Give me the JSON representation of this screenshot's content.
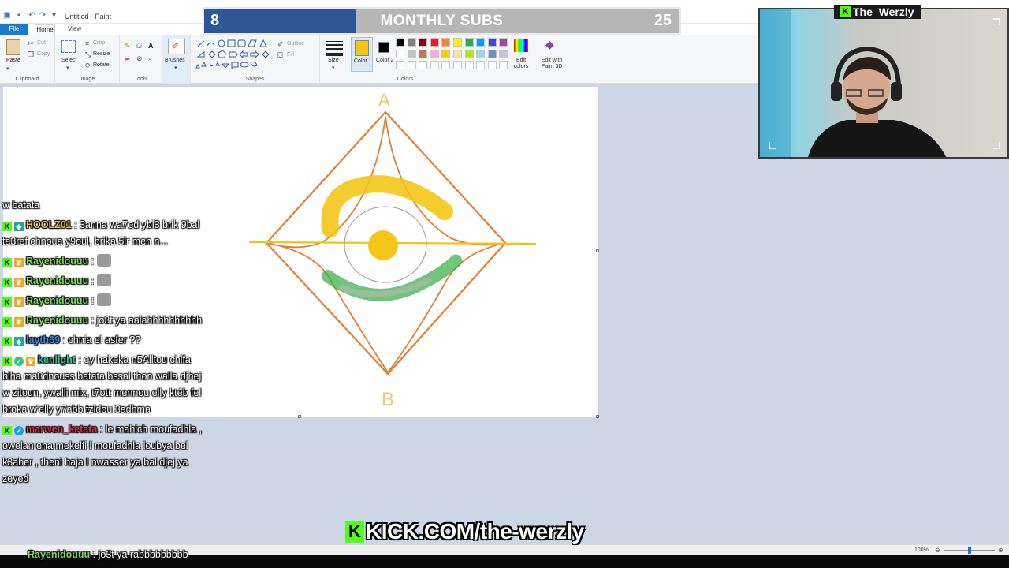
{
  "window": {
    "title": "Untitled - Paint"
  },
  "menu": {
    "file": "File",
    "home": "Home",
    "view": "View"
  },
  "ribbon": {
    "clipboard": {
      "label": "Clipboard",
      "paste": "Paste",
      "cut": "Cut",
      "copy": "Copy"
    },
    "image": {
      "label": "Image",
      "select": "Select",
      "crop": "Crop",
      "resize": "Resize",
      "rotate": "Rotate"
    },
    "tools": {
      "label": "Tools"
    },
    "brushes": {
      "label": "Brushes"
    },
    "shapes": {
      "label": "Shapes",
      "outline": "Outline",
      "fill": "Fill"
    },
    "size": {
      "label": "Size"
    },
    "colors": {
      "label": "Colors",
      "color1": "Color 1",
      "color2": "Color 2",
      "edit_colors": "Edit colors",
      "paint3d": "Edit with Paint 3D",
      "color1_value": "#f5c518",
      "color2_value": "#000000",
      "palette_row1": [
        "#000000",
        "#7f7f7f",
        "#880015",
        "#ed1c24",
        "#ff7f27",
        "#fff200",
        "#22b14c",
        "#00a2e8",
        "#3f48cc",
        "#a349a4"
      ],
      "palette_row2": [
        "#ffffff",
        "#c3c3c3",
        "#b97a57",
        "#ffaec9",
        "#ffc90e",
        "#efe4b0",
        "#b5e61d",
        "#99d9ea",
        "#7092be",
        "#c8bfe7"
      ]
    }
  },
  "canvas": {
    "letter_top": "A",
    "letter_bottom": "B"
  },
  "status": {
    "zoom": "100%"
  },
  "subs_goal": {
    "current": "8",
    "label": "MONTHLY SUBS",
    "goal": "25",
    "progress": 0.32
  },
  "webcam": {
    "channel_name": "The_Werzly"
  },
  "chat": [
    {
      "user": "",
      "color": "#ffffff",
      "badges": [],
      "text": "w batata",
      "emotes": 0
    },
    {
      "user": "HOOLZ01",
      "color": "#f2c230",
      "badges": [
        "kick",
        "og"
      ],
      "text": ": 3anna wa7ed ybi3 brik 9bal ta3ref chnoua y9oul, brika 5ir men n...",
      "emotes": 0
    },
    {
      "user": "Rayenidouuu",
      "color": "#7ed957",
      "badges": [
        "kick",
        "sub"
      ],
      "text": ":",
      "emotes": 1
    },
    {
      "user": "Rayenidouuu",
      "color": "#7ed957",
      "badges": [
        "kick",
        "sub"
      ],
      "text": ":",
      "emotes": 1
    },
    {
      "user": "Rayenidouuu",
      "color": "#7ed957",
      "badges": [
        "kick",
        "sub"
      ],
      "text": ":",
      "emotes": 1
    },
    {
      "user": "Rayenidouuu",
      "color": "#7ed957",
      "badges": [
        "kick",
        "sub"
      ],
      "text": ": jo3t ya aalahhhhhhhhhh",
      "emotes": 0
    },
    {
      "user": "layth69",
      "color": "#3b8ee8",
      "badges": [
        "kick",
        "og"
      ],
      "text": ": chnia el asfer ??",
      "emotes": 0
    },
    {
      "user": "kenlight",
      "color": "#2ecc9a",
      "badges": [
        "kick",
        "chk",
        "sub"
      ],
      "text": ": ey hakeka n5Alltou chifa biha ma3dnouss batata bssal thon walla djhej w zitoun, ywalli mix, t7ott mennou elly ktéb fel broka w'elly y7abb tzidou 3adhma",
      "emotes": 0
    },
    {
      "user": "marwen_ketata",
      "color": "#e0304c",
      "badges": [
        "kick",
        "ver"
      ],
      "text": ": le mahich moufadhla , owelan ena mekelfi l moufadhla loubya bel k3aber , theni haja l nwasser ya bal djej ya zeyed",
      "emotes": 0
    },
    {
      "user": "Rayenidouuu",
      "color": "#7ed957",
      "badges": [],
      "text": ": jo3t ya rabbbbbbbbb",
      "emotes": 0
    }
  ],
  "footer_url": "KICK.COM/the-werzly"
}
